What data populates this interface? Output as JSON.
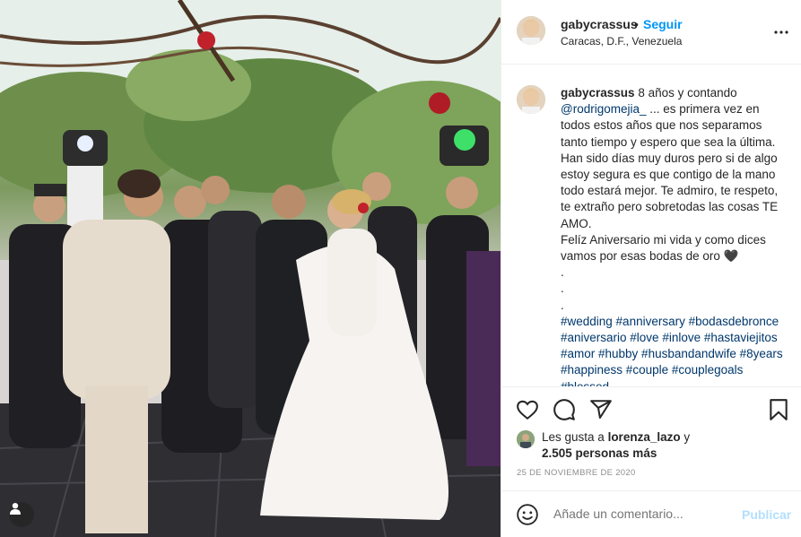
{
  "post": {
    "username": "gabycrassus",
    "separator": "•",
    "follow_label": "Seguir",
    "location": "Caracas, D.F., Venezuela",
    "more_icon": "more-dots-icon"
  },
  "caption": {
    "username": "gabycrassus",
    "text_before_mention": " 8 años y contando ",
    "mention": "@rodrigomejia_",
    "text_after_mention": " ... es primera vez en todos estos años que nos separamos tanto tiempo y espero que sea la última. Han sido días muy duros pero si de algo estoy segura es que contigo de la mano todo estará mejor. Te admiro, te respeto, te extraño pero sobretodas las cosas TE AMO.\nFelíz Aniversario mi vida y como dices vamos por esas bodas de oro 🖤\n.\n.\n.\n",
    "hashtags": "#wedding #anniversary #bodasdebronce #aniversario #love #inlove #hastaviejitos #amor #hubby #husbandandwife #8years #happiness #couple #couplegoals #blessed"
  },
  "actions": {
    "like_icon": "heart-icon",
    "comment_icon": "comment-icon",
    "share_icon": "share-icon",
    "save_icon": "bookmark-icon"
  },
  "likes": {
    "prefix": "Les gusta a ",
    "first_user": "lorenza_lazo",
    "conj": " y",
    "others": "2.505 personas más"
  },
  "date": "25 DE NOVIEMBRE DE 2020",
  "comment": {
    "placeholder": "Añade un comentario...",
    "post_label": "Publicar"
  },
  "colors": {
    "link": "#0095f6",
    "hashtag": "#00376b",
    "muted": "#8e8e8e"
  }
}
